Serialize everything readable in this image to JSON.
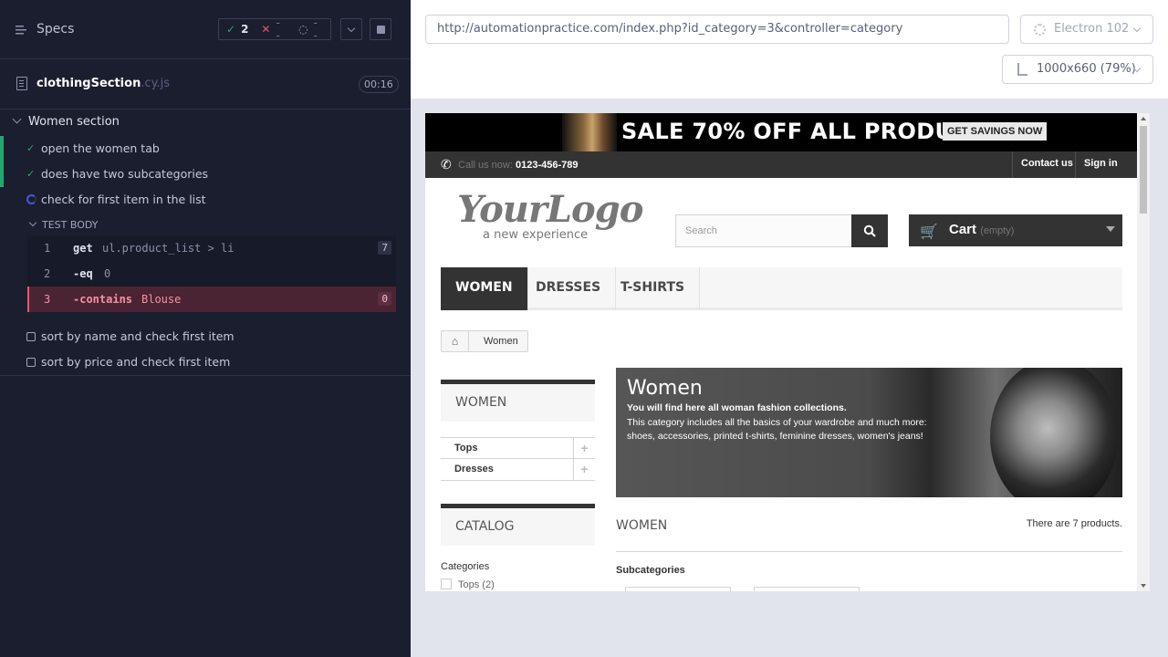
{
  "reporter": {
    "specs_label": "Specs",
    "stats": {
      "passed": "2",
      "failed": "--",
      "pending": "--"
    },
    "file": {
      "name": "clothingSection",
      "ext": ".cy.js",
      "duration": "00:16"
    },
    "suite": {
      "title": "Women section"
    },
    "tests": [
      {
        "title": "open the women tab",
        "state": "passed"
      },
      {
        "title": "does have two subcategories",
        "state": "passed"
      },
      {
        "title": "check for first item in the list",
        "state": "running"
      },
      {
        "title": "sort by name and check first item",
        "state": "pending"
      },
      {
        "title": "sort by price and check first item",
        "state": "pending"
      }
    ],
    "test_body_label": "TEST BODY",
    "commands": [
      {
        "num": "1",
        "name": "get",
        "message": "ul.product_list > li",
        "count": "7"
      },
      {
        "num": "2",
        "name": "-eq",
        "message": "0",
        "count": ""
      },
      {
        "num": "3",
        "name": "-contains",
        "message": "Blouse",
        "count": "0"
      }
    ]
  },
  "aut": {
    "url": "http://automationpractice.com/index.php?id_category=3&controller=category",
    "browser": "Electron 102",
    "viewport": "1000x660",
    "scale": "(79%)"
  },
  "site": {
    "banner_text": "SALE 70% OFF ALL PRODUCTS",
    "banner_button": "GET SAVINGS NOW",
    "call_label": "Call us now: ",
    "phone": "0123-456-789",
    "contact_link": "Contact us",
    "signin_link": "Sign in",
    "logo_main": "YourLogo",
    "logo_tagline": "a new experience",
    "search_placeholder": "Search",
    "cart_label": "Cart",
    "cart_status": "(empty)",
    "menu": [
      "WOMEN",
      "DRESSES",
      "T-SHIRTS"
    ],
    "breadcrumb_current": "Women",
    "sidebar_title": "WOMEN",
    "sidebar_items": [
      "Tops",
      "Dresses"
    ],
    "catalog_title": "CATALOG",
    "categories_label": "Categories",
    "category_option": "Tops (2)",
    "category_banner": {
      "title": "Women",
      "subtitle": "You will find here all woman fashion collections.",
      "description": "This category includes all the basics of your wardrobe and much more: shoes, accessories, printed t-shirts, feminine dresses, women's jeans!"
    },
    "category_heading": "WOMEN",
    "products_count": "There are 7 products.",
    "subcategories_label": "Subcategories"
  },
  "colors": {
    "passed": "#1fa971",
    "failed": "#e45770",
    "running": "#4956e3"
  }
}
